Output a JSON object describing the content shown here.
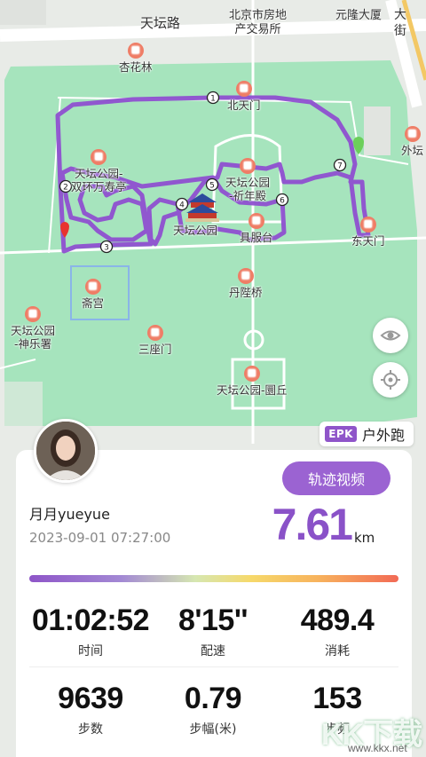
{
  "map": {
    "roads": [
      "天坛路",
      "北京市房地\n产交易所",
      "元隆大厦",
      "大\n街"
    ],
    "pois": [
      {
        "name": "杏花林"
      },
      {
        "name": "北天门"
      },
      {
        "name": "天坛公园-\n双环万寿亭"
      },
      {
        "name": "天坛公园\n-祈年殿"
      },
      {
        "name": "天坛公园"
      },
      {
        "name": "具服台"
      },
      {
        "name": "外坛"
      },
      {
        "name": "东天门"
      },
      {
        "name": "斋宫"
      },
      {
        "name": "丹陛桥"
      },
      {
        "name": "天坛公园\n-神乐署"
      },
      {
        "name": "三座门"
      },
      {
        "name": "天坛公园-圜丘"
      }
    ],
    "checkpoints": [
      "1",
      "2",
      "3",
      "4",
      "5",
      "6",
      "7"
    ],
    "route_color": "#8e4fd0"
  },
  "sport": {
    "badge": "EPK",
    "type": "户外跑"
  },
  "user": {
    "name": "月月yueyue",
    "datetime": "2023-09-01 07:27:00"
  },
  "video_button": "轨迹视频",
  "distance": {
    "value": "7.61",
    "unit": "km"
  },
  "stats": [
    {
      "value": "01:02:52",
      "label": "时间"
    },
    {
      "value": "8'15''",
      "label": "配速"
    },
    {
      "value": "489.4",
      "label": "消耗"
    },
    {
      "value": "9639",
      "label": "步数"
    },
    {
      "value": "0.79",
      "label": "步幅(米)"
    },
    {
      "value": "153",
      "label": "步频"
    }
  ],
  "watermark": {
    "brand": "KK下载",
    "url": "www.kkx.net"
  }
}
